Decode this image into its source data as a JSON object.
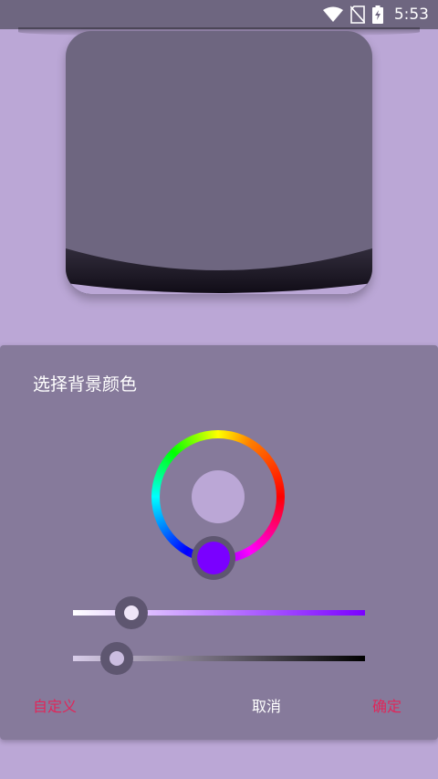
{
  "status_bar": {
    "time": "5:53",
    "icons": [
      "wifi-icon",
      "no-sim-icon",
      "battery-charging-icon"
    ]
  },
  "dialog": {
    "title": "选择背景颜色",
    "hue_color": "#7a00ff",
    "selected_color": "#bba7d6",
    "saturation_slider_value": 0.2,
    "brightness_slider_value": 0.15,
    "buttons": {
      "custom": "自定义",
      "cancel": "取消",
      "ok": "确定"
    }
  },
  "colors": {
    "background": "#bba7d6",
    "preview_card": "#6e6680",
    "dialog_bg": "#867a9b",
    "accent": "#e0265a"
  }
}
